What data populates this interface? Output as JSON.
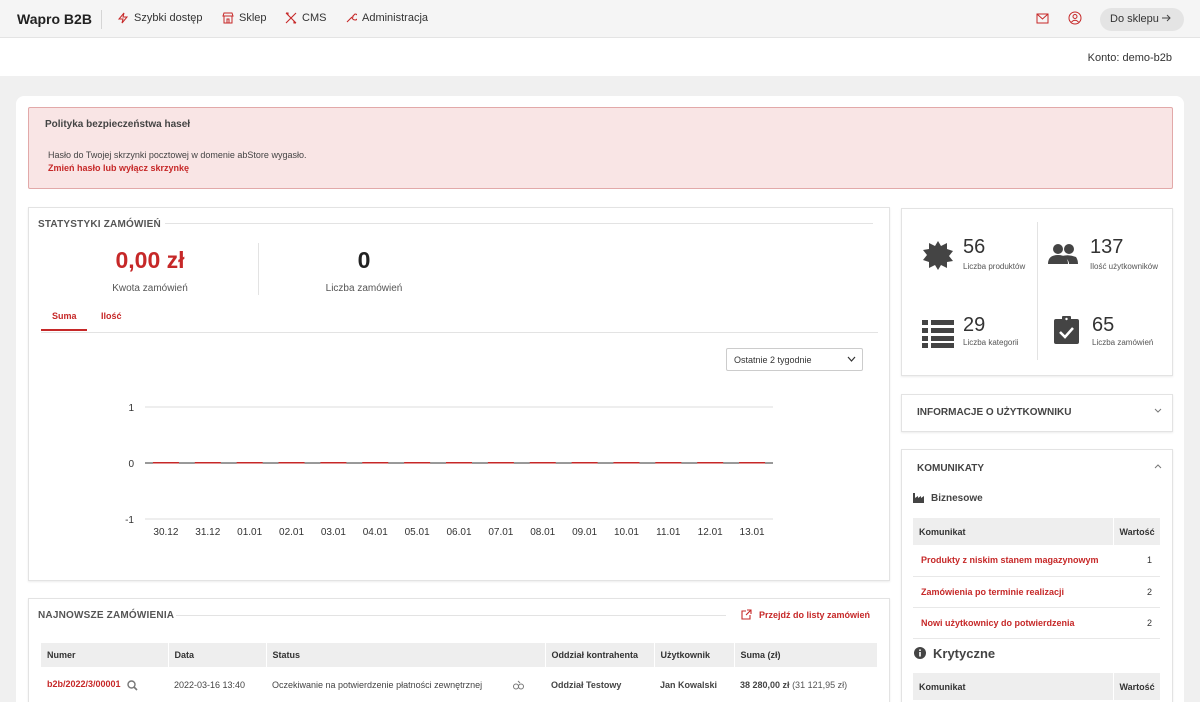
{
  "topbar": {
    "brand": "Wapro B2B",
    "nav": [
      {
        "label": "Szybki dostęp",
        "icon": "lightning-icon"
      },
      {
        "label": "Sklep",
        "icon": "store-icon"
      },
      {
        "label": "CMS",
        "icon": "tools-icon"
      },
      {
        "label": "Administracja",
        "icon": "wrench-icon"
      }
    ],
    "shop_button": "Do sklepu"
  },
  "account": "Konto: demo-b2b",
  "alert": {
    "title": "Polityka bezpieczeństwa haseł",
    "message": "Hasło do Twojej skrzynki pocztowej w domenie abStore wygasło.",
    "link": "Zmień hasło lub wyłącz skrzynkę"
  },
  "stats": {
    "title": "STATYSTYKI ZAMÓWIEŃ",
    "amount": "0,00 zł",
    "amount_label": "Kwota zamówień",
    "count": "0",
    "count_label": "Liczba zamówień",
    "tabs": [
      "Suma",
      "Ilość"
    ],
    "period_select": "Ostatnie 2 tygodnie"
  },
  "chart_data": {
    "type": "bar",
    "categories": [
      "30.12",
      "31.12",
      "01.01",
      "02.01",
      "03.01",
      "04.01",
      "05.01",
      "06.01",
      "07.01",
      "08.01",
      "09.01",
      "10.01",
      "11.01",
      "12.01",
      "13.01"
    ],
    "values": [
      0,
      0,
      0,
      0,
      0,
      0,
      0,
      0,
      0,
      0,
      0,
      0,
      0,
      0,
      0
    ],
    "yticks": [
      "1",
      "0",
      "-1"
    ],
    "ylim": [
      -1,
      1
    ],
    "title": "",
    "xlabel": "",
    "ylabel": "",
    "grid": true,
    "color": "#c62828"
  },
  "orders": {
    "title": "NAJNOWSZE ZAMÓWIENIA",
    "link": "Przejdź do listy zamówień",
    "columns": [
      "Numer",
      "Data",
      "Status",
      "Oddział kontrahenta",
      "Użytkownik",
      "Suma (zł)"
    ],
    "rows": [
      {
        "number": "b2b/2022/3/00001",
        "date": "2022-03-16 13:40",
        "status": "Oczekiwanie na potwierdzenie płatności zewnętrznej",
        "branch": "Oddział Testowy",
        "user": "Jan Kowalski",
        "sum": "38 280,00 zł",
        "sum_net": "(31 121,95 zł)"
      }
    ]
  },
  "summary": {
    "products": {
      "value": "56",
      "label": "Liczba produktów",
      "icon": "badge-icon"
    },
    "users": {
      "value": "137",
      "label": "Ilość użytkowników",
      "icon": "users-icon"
    },
    "categories": {
      "value": "29",
      "label": "Liczba kategorii",
      "icon": "list-icon"
    },
    "orders": {
      "value": "65",
      "label": "Liczba zamówień",
      "icon": "clipboard-check-icon"
    }
  },
  "user_info": {
    "title": "INFORMACJE O UŻYTKOWNIKU"
  },
  "messages": {
    "title": "KOMUNIKATY",
    "business": {
      "title": "Biznesowe",
      "columns": [
        "Komunikat",
        "Wartość"
      ],
      "rows": [
        {
          "label": "Produkty z niskim stanem magazynowym",
          "value": "1"
        },
        {
          "label": "Zamówienia po terminie realizacji",
          "value": "2"
        },
        {
          "label": "Nowi użytkownicy do potwierdzenia",
          "value": "2"
        }
      ]
    },
    "critical": {
      "title": "Krytyczne",
      "columns": [
        "Komunikat",
        "Wartość"
      ]
    }
  }
}
